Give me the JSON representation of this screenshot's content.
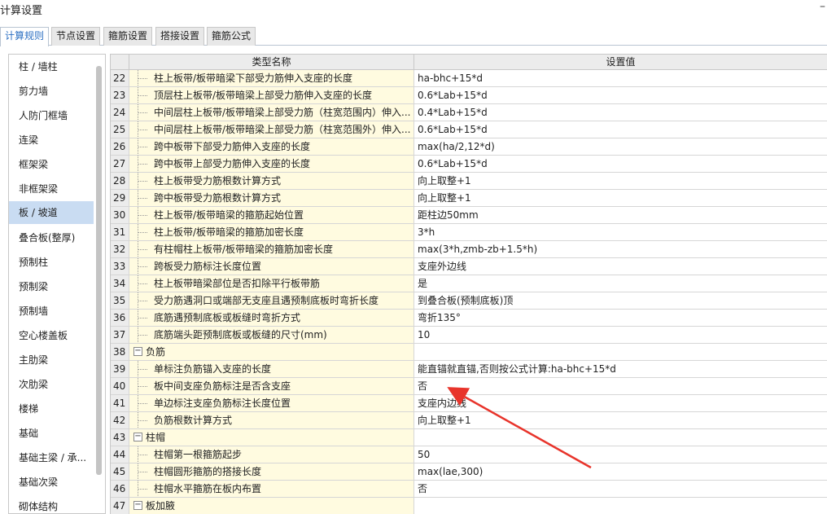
{
  "window": {
    "title": "计算设置",
    "minimize_symbol": "–"
  },
  "tabs": [
    {
      "label": "计算规则",
      "active": true
    },
    {
      "label": "节点设置",
      "active": false
    },
    {
      "label": "箍筋设置",
      "active": false
    },
    {
      "label": "搭接设置",
      "active": false
    },
    {
      "label": "箍筋公式",
      "active": false
    }
  ],
  "sidebar": {
    "items": [
      {
        "label": "柱 / 墙柱"
      },
      {
        "label": "剪力墙"
      },
      {
        "label": "人防门框墙"
      },
      {
        "label": "连梁"
      },
      {
        "label": "框架梁"
      },
      {
        "label": "非框架梁"
      },
      {
        "label": "板 / 坡道",
        "selected": true
      },
      {
        "label": "叠合板(整厚)"
      },
      {
        "label": "预制柱"
      },
      {
        "label": "预制梁"
      },
      {
        "label": "预制墙"
      },
      {
        "label": "空心楼盖板"
      },
      {
        "label": "主肋梁"
      },
      {
        "label": "次肋梁"
      },
      {
        "label": "楼梯"
      },
      {
        "label": "基础"
      },
      {
        "label": "基础主梁 / 承..."
      },
      {
        "label": "基础次梁"
      },
      {
        "label": "砌体结构"
      }
    ]
  },
  "table": {
    "headers": {
      "name": "类型名称",
      "value": "设置值"
    },
    "rows": [
      {
        "num": "22",
        "name": "柱上板带/板带暗梁下部受力筋伸入支座的长度",
        "value": "ha-bhc+15*d"
      },
      {
        "num": "23",
        "name": "顶层柱上板带/板带暗梁上部受力筋伸入支座的长度",
        "value": "0.6*Lab+15*d"
      },
      {
        "num": "24",
        "name": "中间层柱上板带/板带暗梁上部受力筋（柱宽范围内）伸入...",
        "value": "0.4*Lab+15*d"
      },
      {
        "num": "25",
        "name": "中间层柱上板带/板带暗梁上部受力筋（柱宽范围外）伸入...",
        "value": "0.6*Lab+15*d"
      },
      {
        "num": "26",
        "name": "跨中板带下部受力筋伸入支座的长度",
        "value": "max(ha/2,12*d)"
      },
      {
        "num": "27",
        "name": "跨中板带上部受力筋伸入支座的长度",
        "value": "0.6*Lab+15*d"
      },
      {
        "num": "28",
        "name": "柱上板带受力筋根数计算方式",
        "value": "向上取整+1"
      },
      {
        "num": "29",
        "name": "跨中板带受力筋根数计算方式",
        "value": "向上取整+1"
      },
      {
        "num": "30",
        "name": "柱上板带/板带暗梁的箍筋起始位置",
        "value": "距柱边50mm"
      },
      {
        "num": "31",
        "name": "柱上板带/板带暗梁的箍筋加密长度",
        "value": "3*h"
      },
      {
        "num": "32",
        "name": "有柱帽柱上板带/板带暗梁的箍筋加密长度",
        "value": "max(3*h,zmb-zb+1.5*h)"
      },
      {
        "num": "33",
        "name": "跨板受力筋标注长度位置",
        "value": "支座外边线"
      },
      {
        "num": "34",
        "name": "柱上板带暗梁部位是否扣除平行板带筋",
        "value": "是"
      },
      {
        "num": "35",
        "name": "受力筋遇洞口或端部无支座且遇预制底板时弯折长度",
        "value": "到叠合板(预制底板)顶"
      },
      {
        "num": "36",
        "name": "底筋遇预制底板或板缝时弯折方式",
        "value": "弯折135°"
      },
      {
        "num": "37",
        "name": "底筋端头距预制底板或板缝的尺寸(mm)",
        "value": "10"
      },
      {
        "num": "38",
        "name": "负筋",
        "value": "",
        "group": true
      },
      {
        "num": "39",
        "name": "单标注负筋锚入支座的长度",
        "value": "能直锚就直锚,否则按公式计算:ha-bhc+15*d"
      },
      {
        "num": "40",
        "name": "板中间支座负筋标注是否含支座",
        "value": "否"
      },
      {
        "num": "41",
        "name": "单边标注支座负筋标注长度位置",
        "value": "支座内边线"
      },
      {
        "num": "42",
        "name": "负筋根数计算方式",
        "value": "向上取整+1"
      },
      {
        "num": "43",
        "name": "柱帽",
        "value": "",
        "group": true
      },
      {
        "num": "44",
        "name": "柱帽第一根箍筋起步",
        "value": "50"
      },
      {
        "num": "45",
        "name": "柱帽圆形箍筋的搭接长度",
        "value": "max(lae,300)"
      },
      {
        "num": "46",
        "name": "柱帽水平箍筋在板内布置",
        "value": "否"
      },
      {
        "num": "47",
        "name": "板加腋",
        "value": "",
        "group": true
      }
    ]
  },
  "annotation": {
    "color": "#e8342b"
  },
  "colors": {
    "accent": "#2b6fc2",
    "name_cell_bg": "#fffbe0",
    "selected_bg": "#c9dcf2"
  }
}
